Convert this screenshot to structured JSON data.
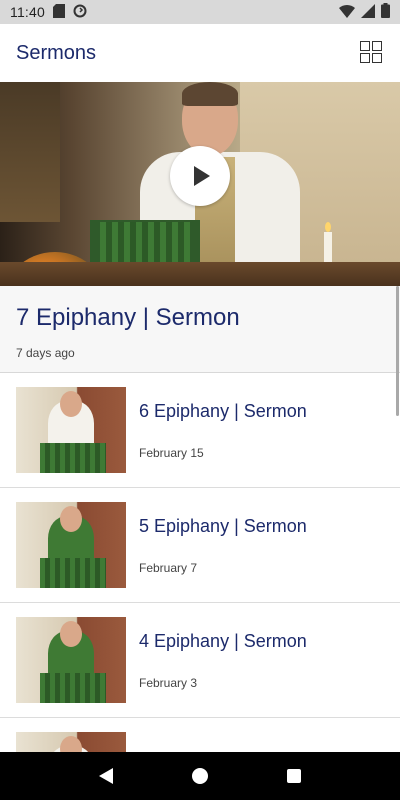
{
  "status_bar": {
    "time": "11:40",
    "icons": [
      "sd-card-icon",
      "sync-icon",
      "wifi-icon",
      "signal-icon",
      "battery-icon"
    ]
  },
  "app_bar": {
    "title": "Sermons",
    "view_toggle_icon": "grid-view-icon"
  },
  "hero": {
    "play_icon": "play-icon"
  },
  "featured": {
    "title": "7 Epiphany | Sermon",
    "date": "7 days ago"
  },
  "sermons": [
    {
      "title": "6 Epiphany | Sermon",
      "date": "February 15"
    },
    {
      "title": "5 Epiphany | Sermon",
      "date": "February 7"
    },
    {
      "title": "4 Epiphany | Sermon",
      "date": "February 3"
    }
  ],
  "nav": {
    "back_icon": "back-triangle-icon",
    "home_icon": "home-circle-icon",
    "recents_icon": "recents-square-icon"
  },
  "colors": {
    "title_blue": "#1c2a6b",
    "status_bar": "#d9d9d9",
    "featured_bg": "#f7f7f7",
    "nav_bar": "#000000"
  }
}
